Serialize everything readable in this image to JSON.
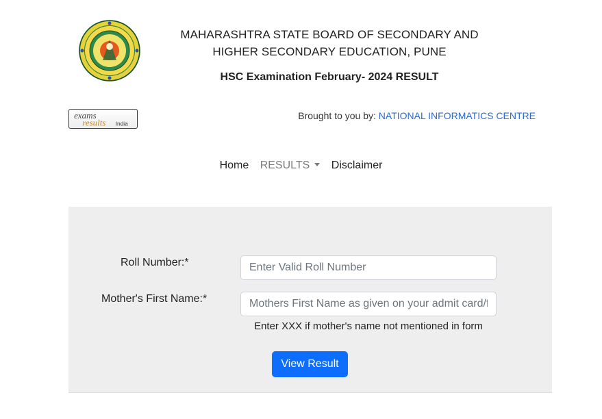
{
  "header": {
    "board_line_1": "MAHARASHTRA STATE BOARD OF SECONDARY AND",
    "board_line_2": "HIGHER SECONDARY EDUCATION, PUNE",
    "exam_title": "HSC Examination February- 2024 RESULT"
  },
  "branding": {
    "logo_text_top": "exams",
    "logo_text_bottom": "results",
    "logo_text_small": "India",
    "brought_prefix": "Brought to you by:",
    "brought_link": "NATIONAL INFORMATICS CENTRE"
  },
  "nav": {
    "home": "Home",
    "results": "RESULTS",
    "disclaimer": "Disclaimer"
  },
  "form": {
    "roll_label": "Roll Number:*",
    "roll_placeholder": "Enter Valid Roll Number",
    "mother_label": "Mother's First Name:*",
    "mother_placeholder": "Mothers First Name as given on your admit card/form",
    "hint": "Enter XXX if mother's name not mentioned in form",
    "submit_label": "View Result"
  },
  "colors": {
    "link": "#2a6ad1",
    "primary_button": "#0d6efd",
    "panel_bg": "#eeeeee"
  }
}
